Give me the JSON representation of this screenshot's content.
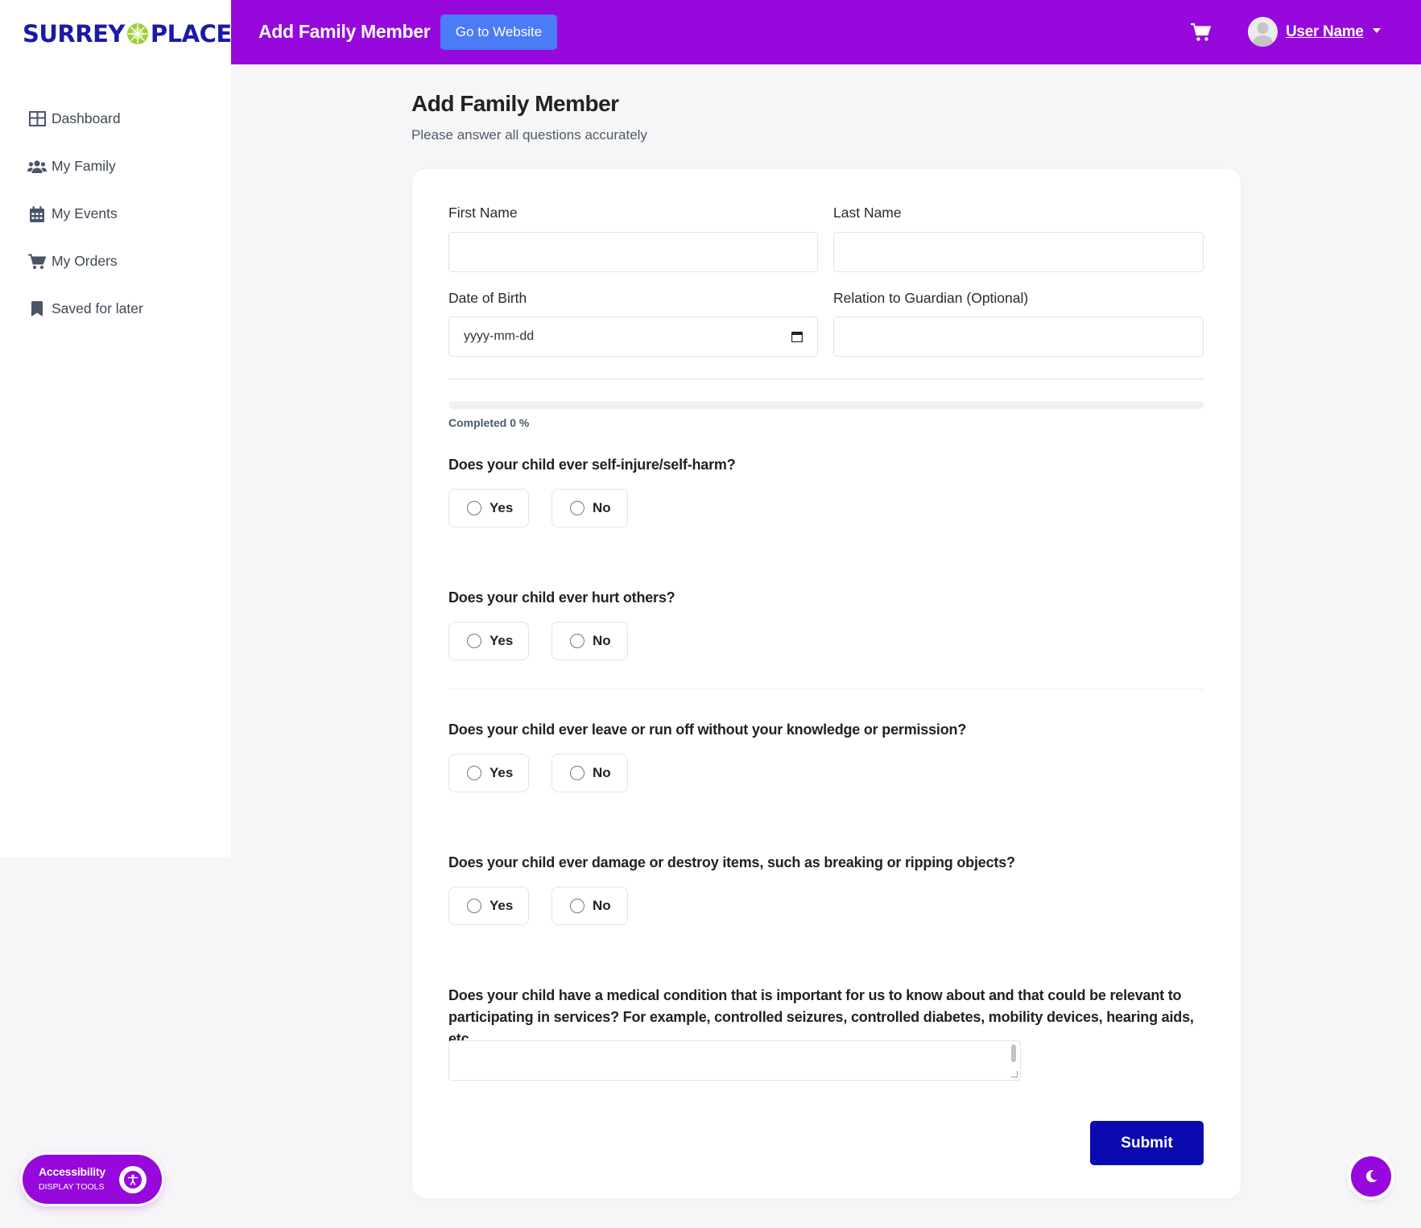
{
  "brand": {
    "left": "SURREY",
    "right": "PLACE"
  },
  "sidebar": {
    "items": [
      {
        "label": "Dashboard",
        "icon": "dashboard-icon"
      },
      {
        "label": "My Family",
        "icon": "users-icon"
      },
      {
        "label": "My Events",
        "icon": "calendar-icon"
      },
      {
        "label": "My Orders",
        "icon": "cart-icon"
      },
      {
        "label": "Saved for later",
        "icon": "bookmark-icon"
      }
    ]
  },
  "header": {
    "title": "Add Family Member",
    "website_button": "Go to Website",
    "username": "User Name",
    "accent_color": "#9608dc"
  },
  "page": {
    "title": "Add Family Member",
    "subtitle": "Please answer all questions accurately"
  },
  "form": {
    "first_name_label": "First Name",
    "first_name_value": "",
    "last_name_label": "Last Name",
    "last_name_value": "",
    "dob_label": "Date of Birth",
    "dob_placeholder": "yyyy-mm-dd",
    "relation_label": "Relation to Guardian (Optional)",
    "relation_value": "",
    "progress_text": "Completed 0 %",
    "progress_percent": 0,
    "questions": [
      {
        "text": "Does your child ever self-injure/self-harm?",
        "yes": "Yes",
        "no": "No",
        "selected": null
      },
      {
        "text": "Does your child ever hurt others?",
        "yes": "Yes",
        "no": "No",
        "selected": null
      },
      {
        "text": "Does your child ever leave or run off without your knowledge or permission?",
        "yes": "Yes",
        "no": "No",
        "selected": null
      },
      {
        "text": "Does your child ever damage or destroy items, such as breaking or ripping objects?",
        "yes": "Yes",
        "no": "No",
        "selected": null
      }
    ],
    "medical_question": "Does your child have a medical condition that is important for us to know about and that could be relevant to participating in services? For example, controlled seizures, controlled diabetes, mobility devices, hearing aids, etc.",
    "medical_value": "",
    "submit_label": "Submit"
  },
  "accessibility": {
    "title": "Accessibility",
    "subtitle": "DISPLAY TOOLS"
  }
}
